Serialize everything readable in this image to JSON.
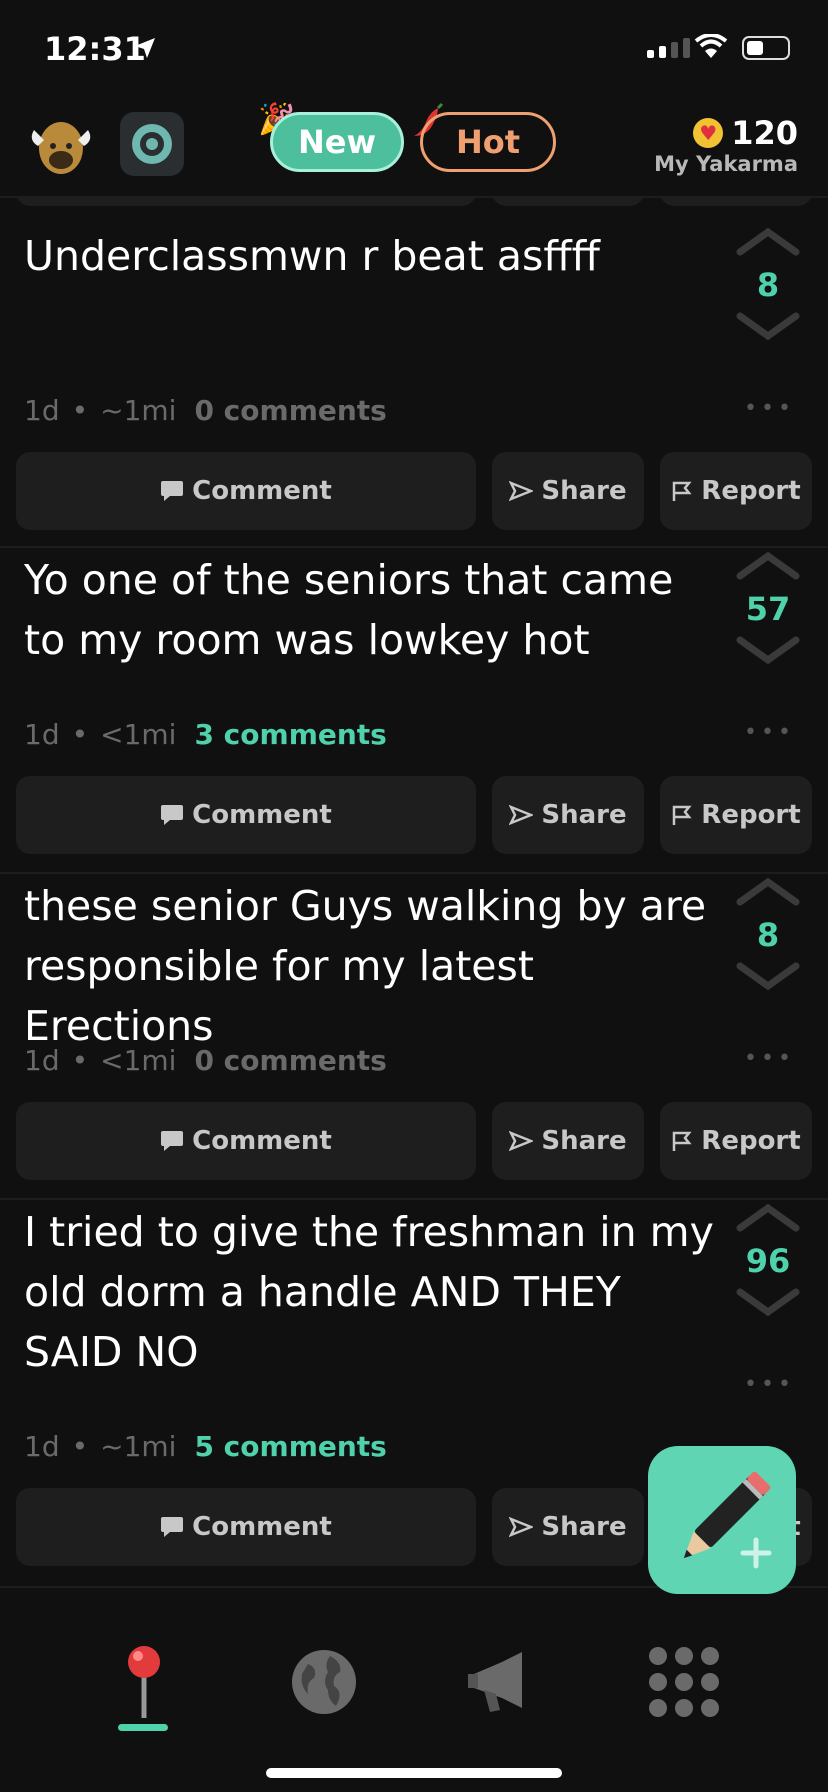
{
  "status_bar": {
    "time": "12:31"
  },
  "header": {
    "tabs": [
      {
        "label": "New",
        "active": true
      },
      {
        "label": "Hot",
        "active": false
      }
    ],
    "karma": {
      "value": "120",
      "label": "My Yakarma"
    },
    "icons": {
      "avatar": "yak-avatar-icon",
      "school": "school-badge-icon",
      "confetti": "party-popper-icon",
      "pepper": "chili-pepper-icon",
      "karma": "heart-coin-icon"
    }
  },
  "actions": {
    "comment": "Comment",
    "share": "Share",
    "report": "Report"
  },
  "posts": [
    {
      "text": "Underclassmwn r beat asffff",
      "time": "1d",
      "distance": "~1mi",
      "comments": "0 comments",
      "has_comments": false,
      "score": "8"
    },
    {
      "text": "Yo one of the seniors that came to my room was lowkey hot",
      "time": "1d",
      "distance": "<1mi",
      "comments": "3 comments",
      "has_comments": true,
      "score": "57"
    },
    {
      "text": "these senior Guys walking by are responsible for my latest Erections",
      "time": "1d",
      "distance": "<1mi",
      "comments": "0 comments",
      "has_comments": false,
      "score": "8"
    },
    {
      "text": "I tried to give the freshman in my old dorm a handle AND THEY SAID NO",
      "time": "1d",
      "distance": "~1mi",
      "comments": "5 comments",
      "has_comments": true,
      "score": "96"
    }
  ],
  "meta_separator": "•",
  "tabbar": [
    {
      "name": "local",
      "icon": "map-pin-icon",
      "active": true
    },
    {
      "name": "explore",
      "icon": "globe-icon",
      "active": false
    },
    {
      "name": "announcements",
      "icon": "megaphone-icon",
      "active": false
    },
    {
      "name": "more",
      "icon": "grid-dots-icon",
      "active": false
    }
  ],
  "colors": {
    "accent": "#4fd1ac",
    "hot": "#f0a070",
    "background": "#101010",
    "button": "#1e1e1e"
  }
}
